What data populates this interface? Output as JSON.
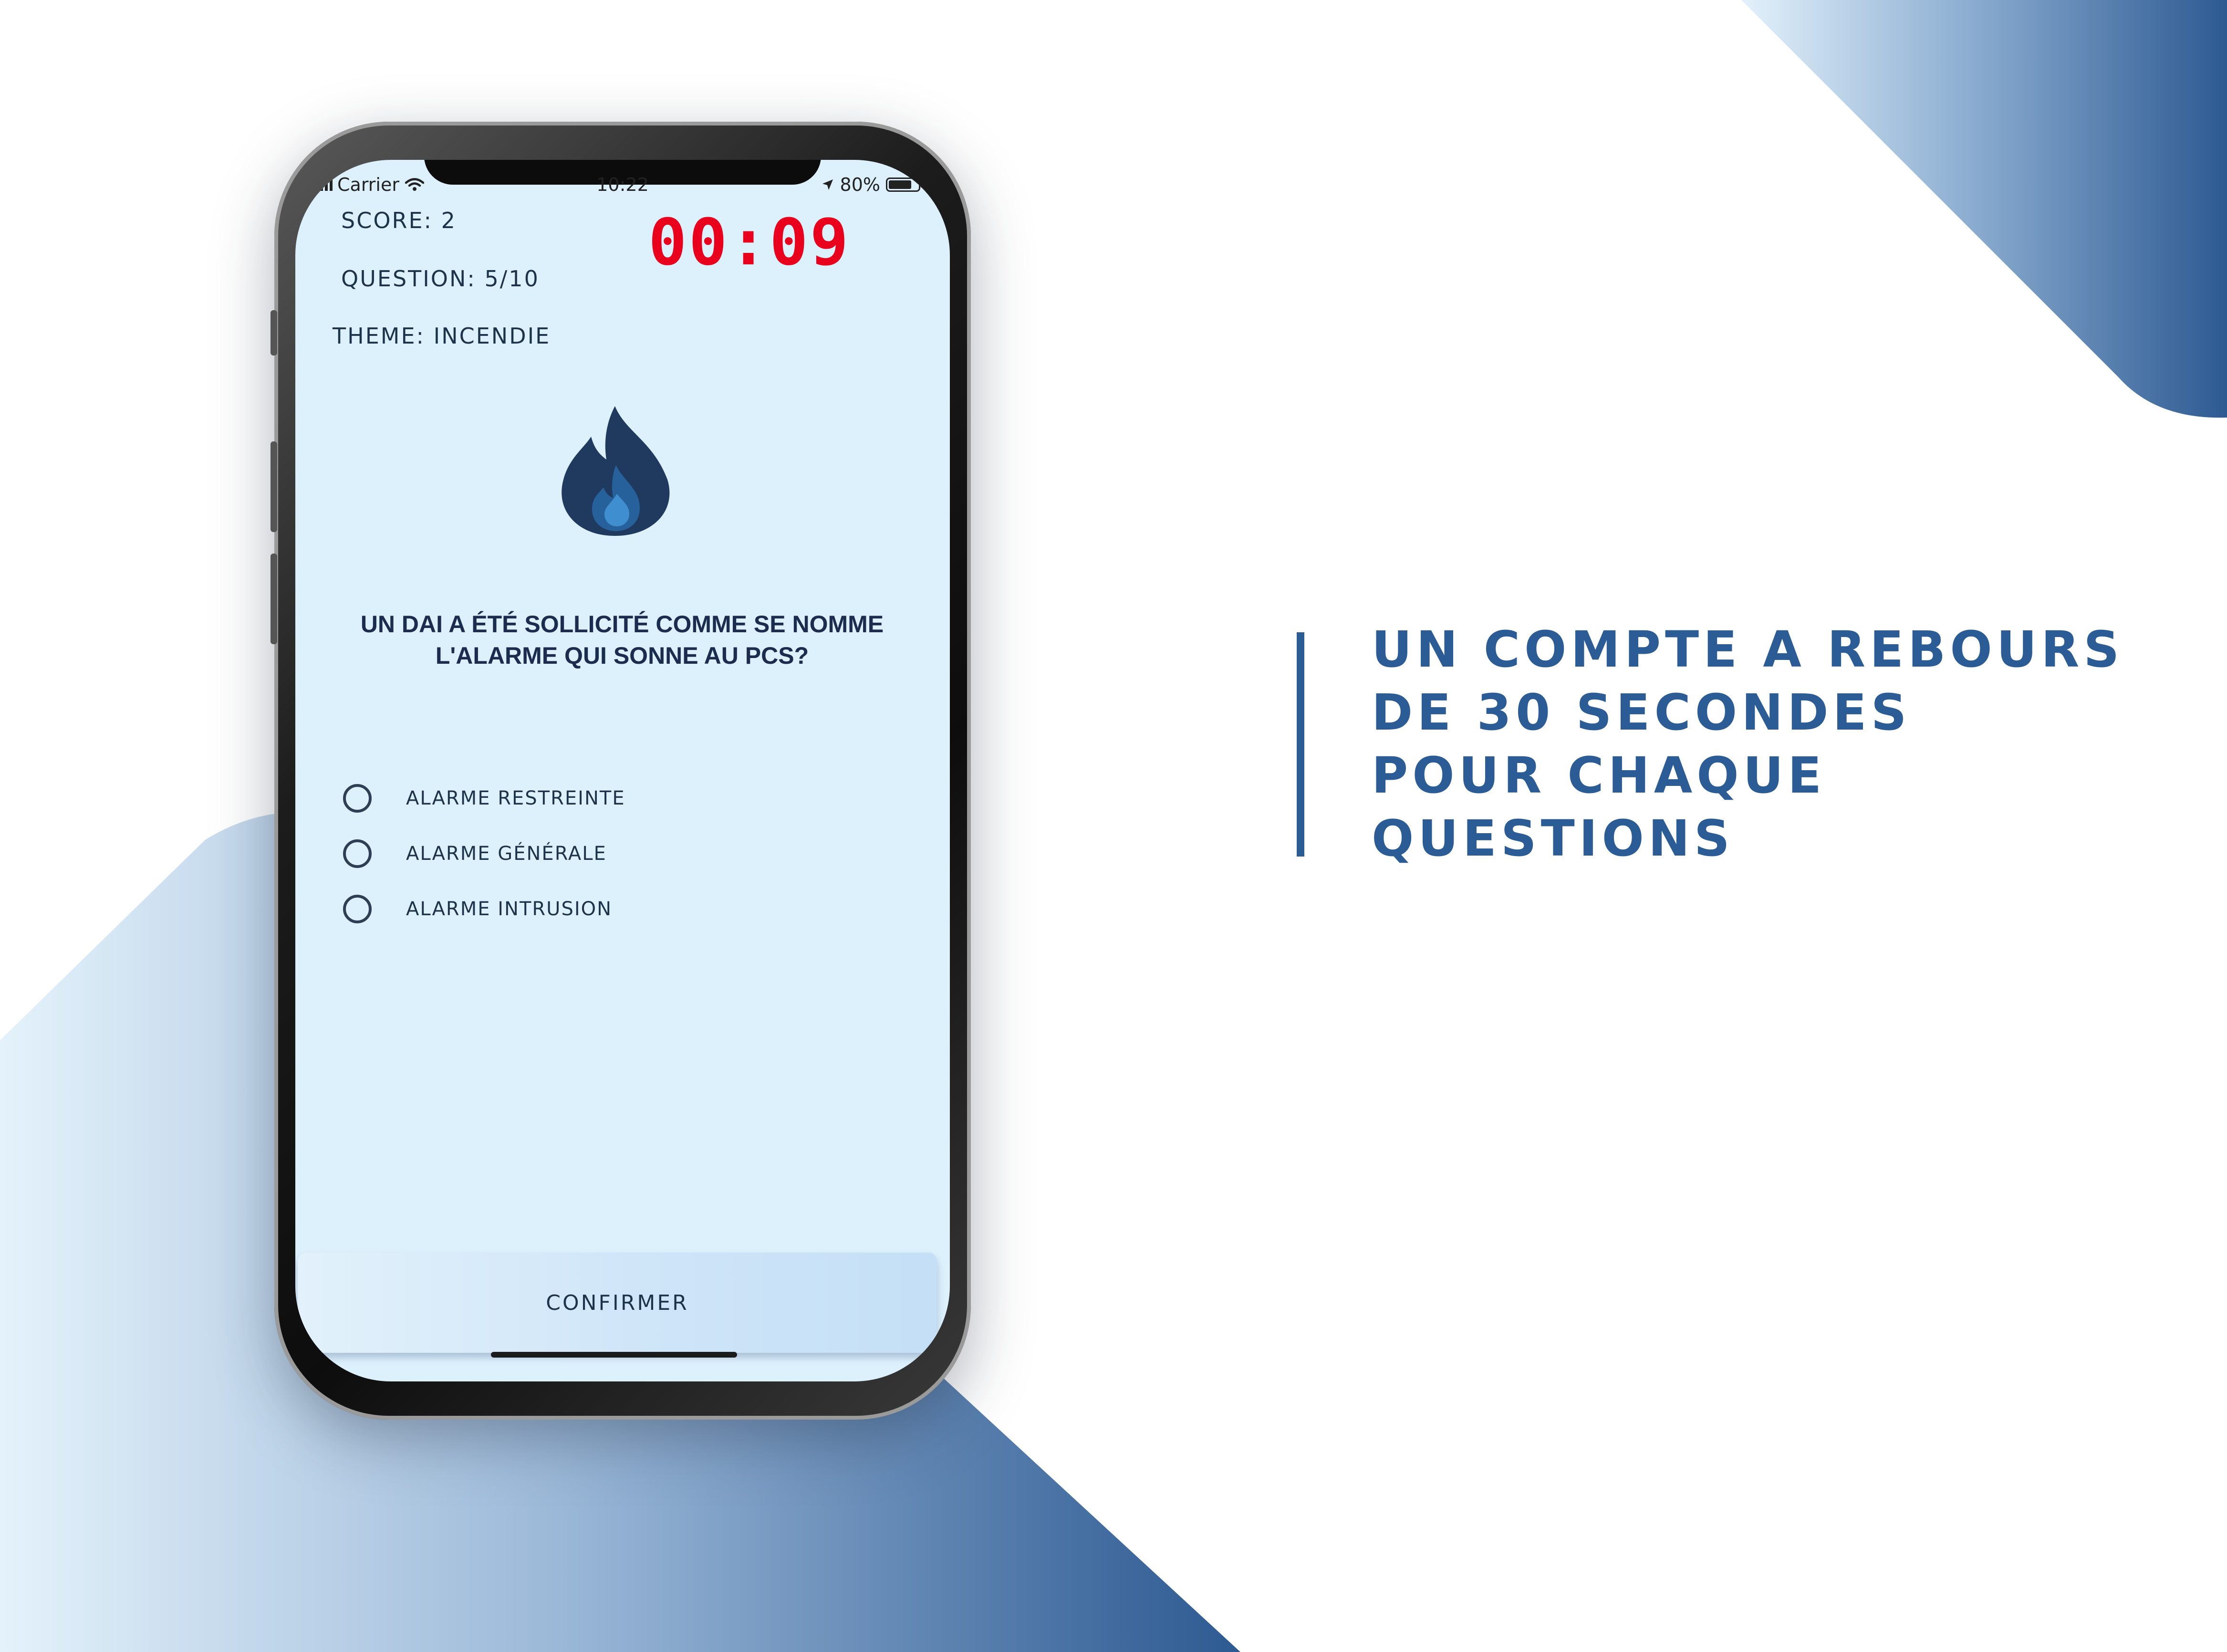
{
  "status_bar": {
    "carrier": "Carrier",
    "time": "10:22",
    "battery": "80%",
    "battery_level": 0.8
  },
  "quiz": {
    "score": "SCORE: 2",
    "question_counter": "QUESTION: 5/10",
    "theme": "THEME: INCENDIE",
    "timer": "00:09",
    "question": "UN DAI A ÉTÉ SOLLICITÉ COMME SE NOMME L'ALARME QUI SONNE AU PCS?",
    "options": [
      {
        "label": "ALARME RESTREINTE"
      },
      {
        "label": "ALARME GÉNÉRALE"
      },
      {
        "label": "ALARME INTRUSION"
      }
    ],
    "confirm_label": "CONFIRMER",
    "icon": "flame-icon"
  },
  "caption": {
    "lines": [
      "UN COMPTE A REBOURS",
      "DE 30 SECONDES",
      "POUR CHAQUE",
      "QUESTIONS"
    ]
  },
  "colors": {
    "accent": "#2c5c95",
    "timer": "#e8001c",
    "screen_bg": "#ddf1fd",
    "text_dark": "#1d3349"
  }
}
